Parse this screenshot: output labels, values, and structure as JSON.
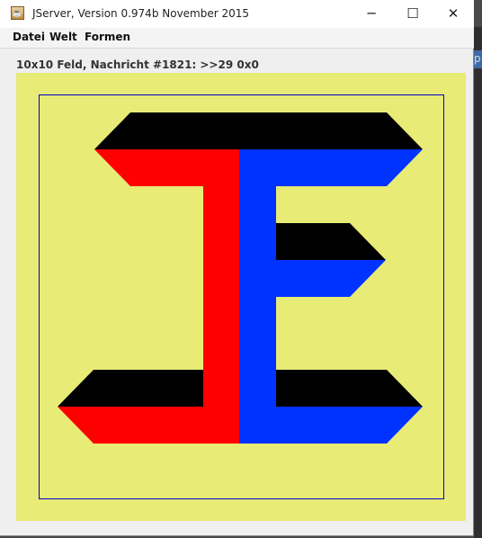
{
  "window": {
    "title": "JServer, Version 0.974b November 2015",
    "icon": "java-cup-icon",
    "controls": {
      "minimize": "─",
      "maximize": "☐",
      "close": "✕"
    }
  },
  "menu": {
    "items": [
      {
        "label": "Datei"
      },
      {
        "label": "Welt"
      },
      {
        "label": "Formen"
      }
    ]
  },
  "status": {
    "text": "10x10 Feld, Nachricht #1821: >>29 0x0"
  },
  "board": {
    "background": "#e8eb75",
    "border_color": "#0000cc",
    "colors": {
      "black": "#000000",
      "red": "#ff0000",
      "blue": "#0033ff"
    }
  },
  "side": {
    "glyph": "p"
  }
}
